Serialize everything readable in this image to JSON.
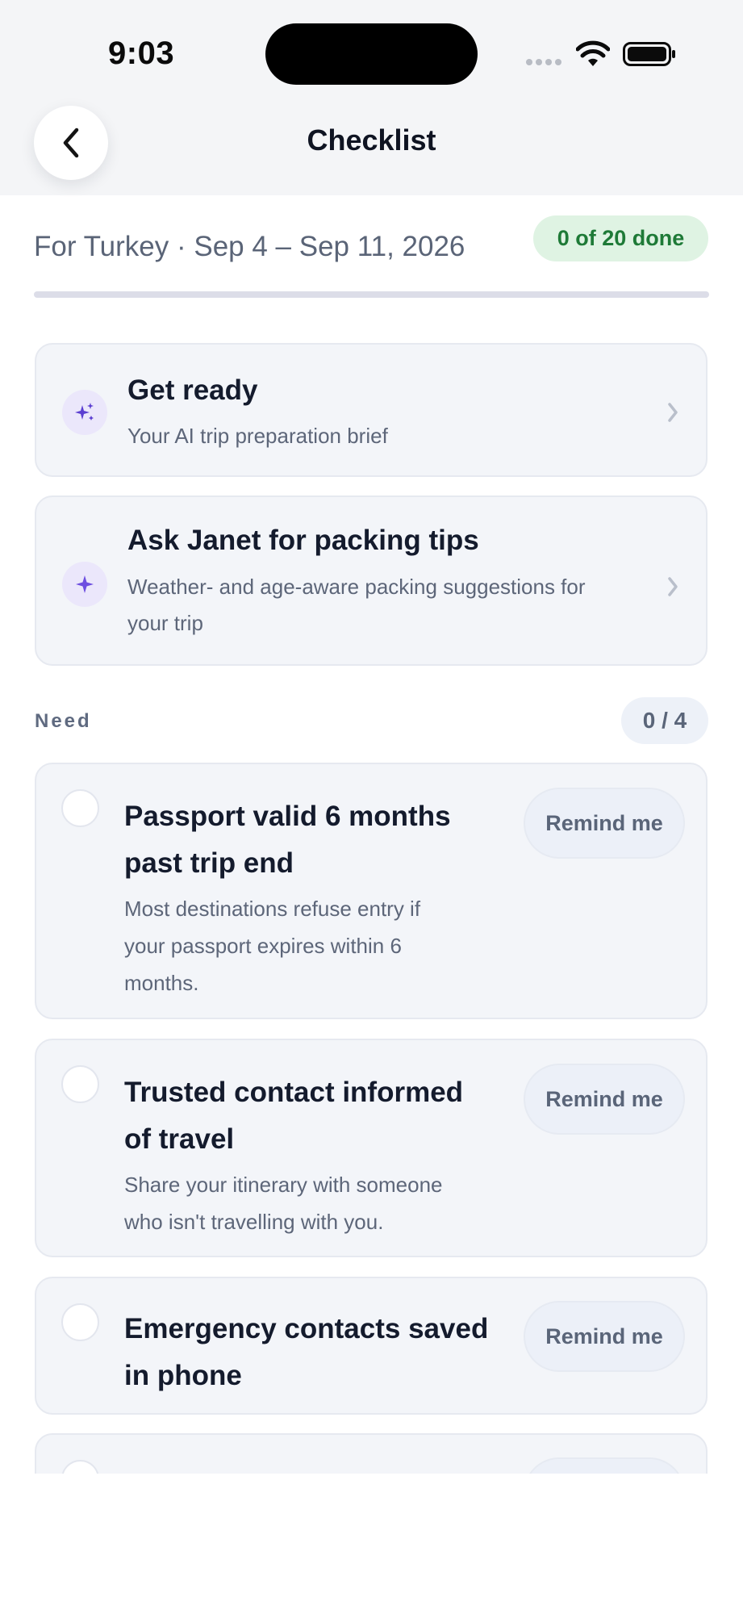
{
  "status_bar": {
    "time": "9:03",
    "icons": [
      "cellular-dots-icon",
      "wifi-icon",
      "battery-icon"
    ]
  },
  "header": {
    "back_icon": "chevron-left-icon",
    "title": "Checklist"
  },
  "trip": {
    "subtitle": "For Turkey · Sep 4 – Sep 11, 2026",
    "done_badge": "0 of 20 done",
    "progress_fraction": 0
  },
  "cards": [
    {
      "icon": "sparkles-icon",
      "title": "Get ready",
      "description": "Your AI trip preparation brief"
    },
    {
      "icon": "sparkle-icon",
      "title": "Ask Janet for packing tips",
      "description_lines": [
        "Weather- and age-aware packing suggestions for",
        "your trip"
      ]
    }
  ],
  "section": {
    "label": "Need",
    "count": "0 / 4"
  },
  "items": [
    {
      "title_lines": [
        "Passport valid 6 months",
        "past trip end"
      ],
      "description_lines": [
        "Most destinations refuse entry if",
        "your passport expires within 6",
        "months."
      ],
      "button": "Remind me",
      "checked": false
    },
    {
      "title_lines": [
        "Trusted contact informed",
        "of travel"
      ],
      "description_lines": [
        "Share your itinerary with someone",
        "who isn't travelling with you."
      ],
      "button": "Remind me",
      "checked": false
    },
    {
      "title_lines": [
        "Emergency contacts saved",
        "in phone"
      ],
      "button": "Remind me",
      "checked": false
    }
  ],
  "colors": {
    "accent_purple": "#6d4ee0",
    "done_green": "#1e7a37",
    "card_bg": "#f3f5f9"
  }
}
